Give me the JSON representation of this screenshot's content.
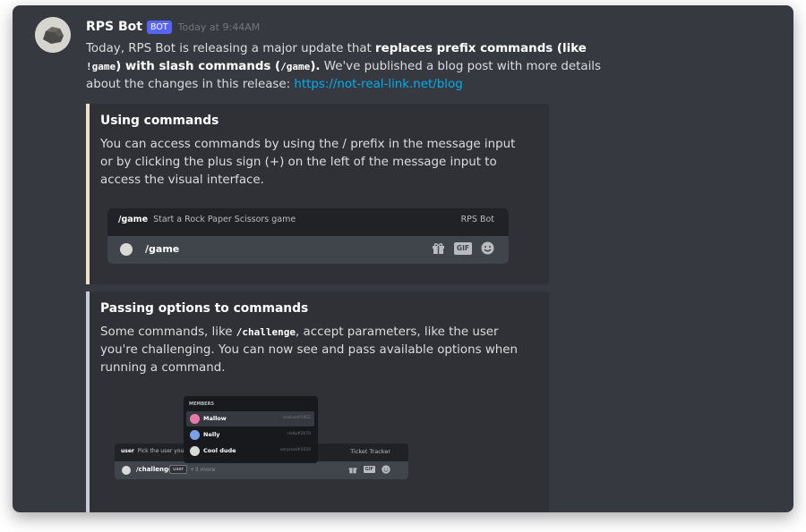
{
  "message": {
    "username": "RPS Bot",
    "bot_tag": "BOT",
    "timestamp": "Today at 9:44AM",
    "text_1": "Today, RPS Bot is releasing a major update that ",
    "bold_1": "replaces prefix commands (like ",
    "code_1": "!game",
    "bold_2": ") with slash commands (",
    "code_2": "/game",
    "bold_3": ").",
    "text_2": " We've published a blog post with more details about the changes in this release: ",
    "link": "https://not-real-link.net/blog"
  },
  "embeds": [
    {
      "title": "Using commands",
      "description": "You can access commands by using the / prefix in the message input or by clicking the plus sign (+) on the left of the message input to access the visual interface.",
      "accent": "#e9e2c8",
      "preview": {
        "command": "/game",
        "command_desc": "Start a Rock Paper Scissors game",
        "bot_name": "RPS Bot",
        "input_text": "/game",
        "gif_label": "GIF"
      }
    },
    {
      "title": "Passing options to commands",
      "desc_1": "Some commands, like ",
      "desc_code": "/challenge",
      "desc_2": ", accept parameters, like the user you're challenging. You can now see and pass available options when running a command.",
      "accent": "#c7ccd6",
      "preview": {
        "members_header": "MEMBERS",
        "members": [
          {
            "name": "Mallow",
            "tag": "mallow#1952",
            "color": "#e879a6"
          },
          {
            "name": "Nelly",
            "tag": "nelly#2070",
            "color": "#7aa0e8"
          },
          {
            "name": "Cool dude",
            "tag": "verycool#1020",
            "color": "#d9d9d6"
          }
        ],
        "option_name": "user",
        "option_desc": "Pick the user you w...",
        "right_label": "Ticket Tracker",
        "input_cmd": "/challenge",
        "chip": "user",
        "more": "+3 more",
        "gif_label": "GIF"
      }
    }
  ],
  "colors": {
    "background": "#36393f",
    "embed_bg": "#2f3136",
    "bot_tag": "#5865f2",
    "link": "#00aff4"
  }
}
